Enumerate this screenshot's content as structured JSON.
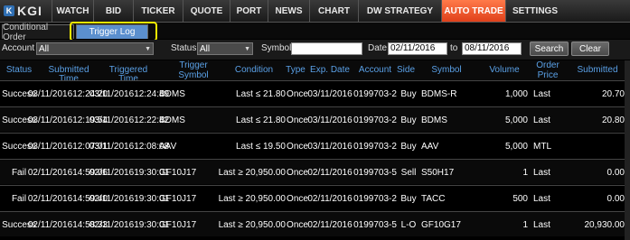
{
  "app": {
    "logo": "KGI",
    "logo_mark": "K"
  },
  "nav": [
    "WATCH",
    "BID",
    "TICKER",
    "QUOTE",
    "PORT",
    "NEWS",
    "CHART",
    "DW STRATEGY",
    "AUTO TRADE",
    "SETTINGS"
  ],
  "nav_active": "AUTO TRADE",
  "subtabs": [
    "Conditional Order",
    "Trigger Log"
  ],
  "filters": {
    "account_label": "Account",
    "account_value": "All",
    "status_label": "Status",
    "status_value": "All",
    "symbol_label": "Symbol",
    "symbol_value": "",
    "date_label": "Date",
    "date_from": "02/11/2016",
    "to_label": "to",
    "date_to": "08/11/2016",
    "search_label": "Search",
    "clear_label": "Clear"
  },
  "columns": {
    "status": "Status",
    "submitted_time": "Submitted Time",
    "triggered_time": "Triggered Time",
    "trigger_symbol_1": "Trigger",
    "trigger_symbol_2": "Symbol",
    "condition": "Condition",
    "type": "Type",
    "exp_date": "Exp. Date",
    "account": "Account",
    "side": "Side",
    "symbol": "Symbol",
    "volume": "Volume",
    "order_price_1": "Order",
    "order_price_2": "Price",
    "submitted": "Submitted"
  },
  "rows": [
    {
      "status": "Success",
      "sub_date": "03/11/2016",
      "sub_time": "12:24:20",
      "trg_date": "03/11/2016",
      "trg_time": "12:24:49",
      "trigger_symbol": "BDMS",
      "condition": "Last ≤ 21.80",
      "type": "Once",
      "exp_date": "03/11/2016",
      "account": "0199703-2",
      "side": "Buy",
      "symbol": "BDMS-R",
      "volume": "1,000",
      "order_price": "Last",
      "submitted": "20.70"
    },
    {
      "status": "Success",
      "sub_date": "03/11/2016",
      "sub_time": "12:19:54",
      "trg_date": "03/11/2016",
      "trg_time": "12:22:42",
      "trigger_symbol": "BDMS",
      "condition": "Last ≤ 21.80",
      "type": "Once",
      "exp_date": "03/11/2016",
      "account": "0199703-2",
      "side": "Buy",
      "symbol": "BDMS",
      "volume": "5,000",
      "order_price": "Last",
      "submitted": "20.80"
    },
    {
      "status": "Success",
      "sub_date": "03/11/2016",
      "sub_time": "12:07:01",
      "trg_date": "03/11/2016",
      "trg_time": "12:08:08",
      "trigger_symbol": "AAV",
      "condition": "Last ≤ 19.50",
      "type": "Once",
      "exp_date": "03/11/2016",
      "account": "0199703-2",
      "side": "Buy",
      "symbol": "AAV",
      "volume": "5,000",
      "order_price": "MTL",
      "submitted": ""
    },
    {
      "status": "Fail",
      "sub_date": "02/11/2016",
      "sub_time": "14:59:06",
      "trg_date": "02/11/2016",
      "trg_time": "19:30:01",
      "trigger_symbol": "GF10J17",
      "condition": "Last ≥ 20,950.00",
      "type": "Once",
      "exp_date": "02/11/2016",
      "account": "0199703-5",
      "side": "Sell",
      "symbol": "S50H17",
      "volume": "1",
      "order_price": "Last",
      "submitted": "0.00"
    },
    {
      "status": "Fail",
      "sub_date": "02/11/2016",
      "sub_time": "14:59:40",
      "trg_date": "02/11/2016",
      "trg_time": "19:30:01",
      "trigger_symbol": "GF10J17",
      "condition": "Last ≥ 20,950.00",
      "type": "Once",
      "exp_date": "02/11/2016",
      "account": "0199703-2",
      "side": "Buy",
      "symbol": "TACC",
      "volume": "500",
      "order_price": "Last",
      "submitted": "0.00"
    },
    {
      "status": "Success",
      "sub_date": "02/11/2016",
      "sub_time": "14:58:33",
      "trg_date": "02/11/2016",
      "trg_time": "19:30:01",
      "trigger_symbol": "GF10J17",
      "condition": "Last ≥ 20,950.00",
      "type": "Once",
      "exp_date": "02/11/2016",
      "account": "0199703-5",
      "side": "L-O",
      "symbol": "GF10G17",
      "volume": "1",
      "order_price": "Last",
      "submitted": "20,930.00"
    }
  ]
}
